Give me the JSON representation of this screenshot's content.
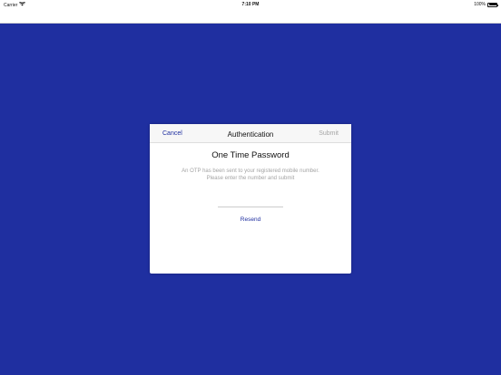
{
  "status_bar": {
    "carrier": "Carrier",
    "wifi_icon": "wifi-icon",
    "time": "7:10 PM",
    "battery_level": "100%",
    "battery_icon": "battery-icon"
  },
  "modal": {
    "cancel_label": "Cancel",
    "title": "Authentication",
    "submit_label": "Submit",
    "heading": "One Time Password",
    "message_line1": "An OTP has been sent to your registered mobile number.",
    "message_line2": "Please enter the number and submit",
    "otp_value": "",
    "resend_label": "Resend"
  },
  "colors": {
    "background": "#1f2fa0",
    "accent": "#1f2fa0",
    "disabled": "#a6a6a6"
  }
}
